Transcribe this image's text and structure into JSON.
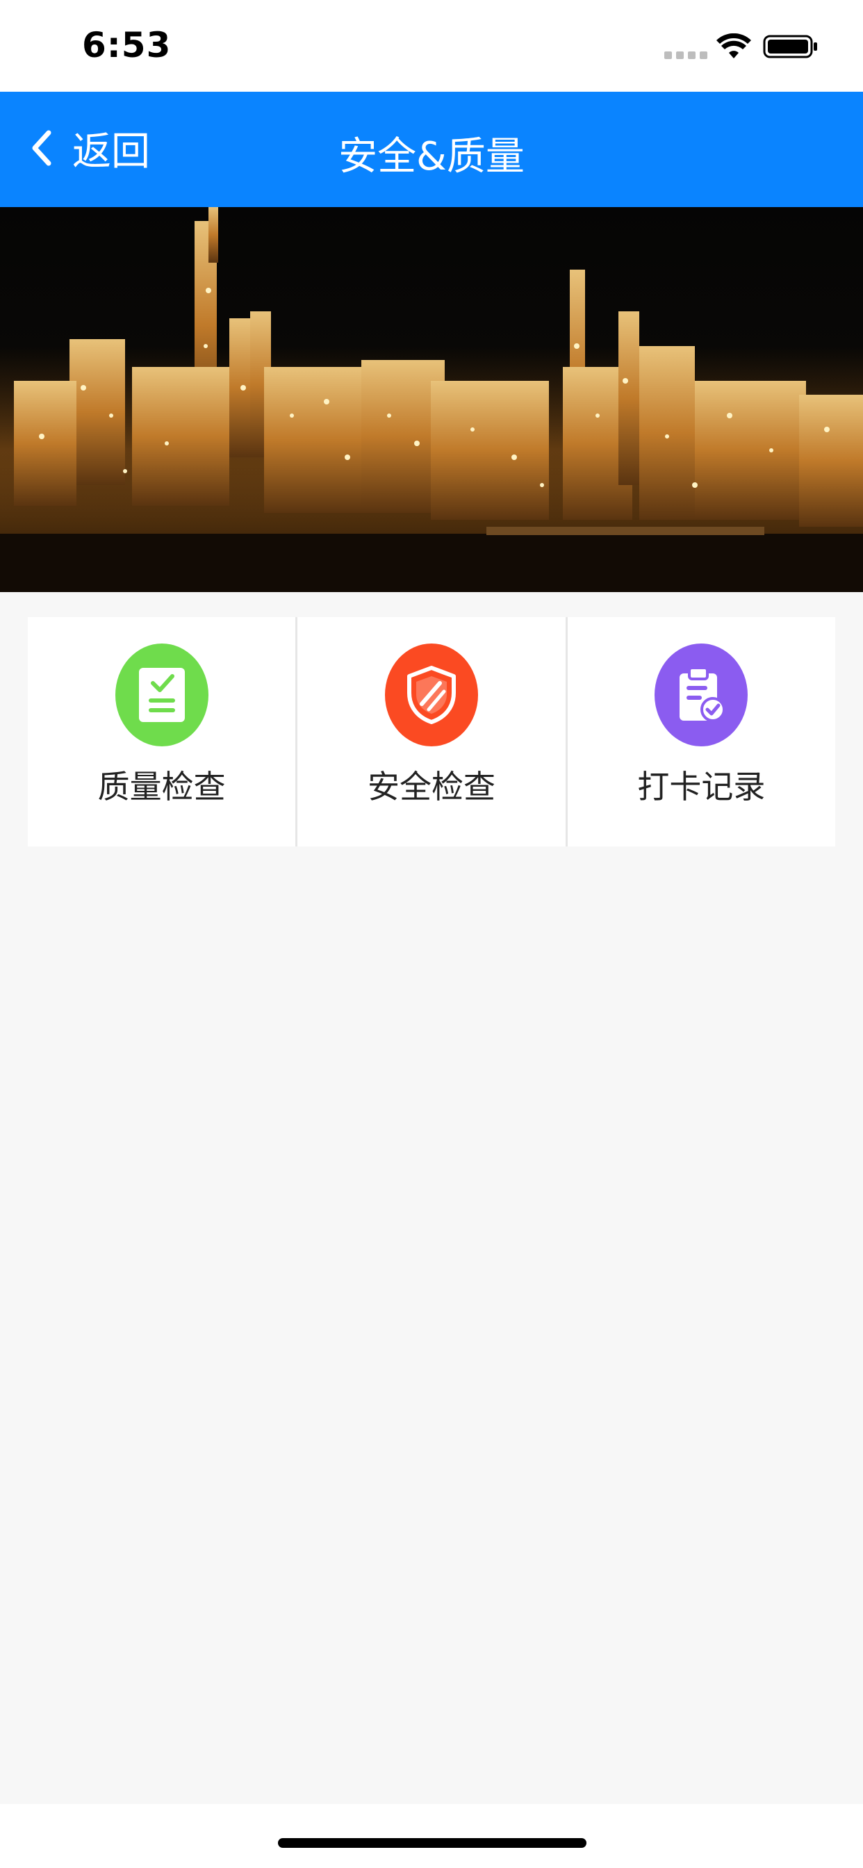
{
  "status_bar": {
    "time": "6:53",
    "icons": [
      "signal-dots-icon",
      "wifi-icon",
      "battery-icon"
    ]
  },
  "nav": {
    "back_label": "返回",
    "title": "安全&质量",
    "background_color": "#0a84ff"
  },
  "banner": {
    "image": "refinery-night-photo",
    "carousel_dots": 1
  },
  "menu": {
    "items": [
      {
        "label": "质量检查",
        "icon": "checklist-document-icon",
        "color": "#6fdc4c"
      },
      {
        "label": "安全检查",
        "icon": "shield-icon",
        "color": "#fb4a22"
      },
      {
        "label": "打卡记录",
        "icon": "clipboard-check-icon",
        "color": "#8b5cf0"
      }
    ]
  }
}
